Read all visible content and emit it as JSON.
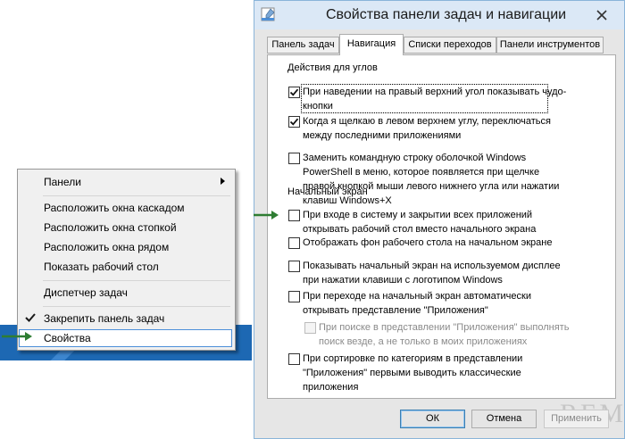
{
  "context_menu": {
    "items": [
      {
        "label": "Панели",
        "submenu": true
      },
      {
        "label": "Расположить окна каскадом"
      },
      {
        "label": "Расположить окна стопкой"
      },
      {
        "label": "Расположить окна рядом"
      },
      {
        "label": "Показать рабочий стол"
      },
      {
        "label": "Диспетчер задач"
      },
      {
        "label": "Закрепить панель задач",
        "checked": true
      },
      {
        "label": "Свойства",
        "highlighted": true
      }
    ]
  },
  "dialog": {
    "title": "Свойства панели задач и навигации",
    "tabs": [
      {
        "label": "Панель задач",
        "active": false
      },
      {
        "label": "Навигация",
        "active": true
      },
      {
        "label": "Списки переходов",
        "active": false
      },
      {
        "label": "Панели инструментов",
        "active": false
      }
    ],
    "corners_section": {
      "heading": "Действия для углов",
      "options": [
        {
          "text": "При наведении на правый верхний угол показывать чудо-кнопки",
          "checked": true
        },
        {
          "text": "Когда я щелкаю в левом верхнем углу, переключаться между последними приложениями",
          "checked": true
        },
        {
          "text": "Заменить командную строку оболочкой Windows PowerShell в меню, которое появляется при щелчке правой кнопкой мыши левого нижнего угла или нажатии клавиш Windows+X",
          "checked": false
        }
      ]
    },
    "start_section": {
      "heading": "Начальный экран",
      "options": [
        {
          "text": "При входе в систему и закрытии всех приложений открывать рабочий стол вместо начального экрана",
          "checked": false
        },
        {
          "text": "Отображать фон рабочего стола на начальном экране",
          "checked": false
        },
        {
          "text": "Показывать начальный экран на используемом дисплее при нажатии клавиши с логотипом Windows",
          "checked": false
        },
        {
          "text": "При переходе на начальный экран автоматически открывать представление \"Приложения\"",
          "checked": false
        },
        {
          "text": "При поиске в представлении \"Приложения\" выполнять поиск везде, а не только в моих приложениях",
          "checked": false,
          "disabled": true
        },
        {
          "text": "При сортировке по категориям в представлении \"Приложения\" первыми выводить классические приложения",
          "checked": false
        }
      ]
    },
    "buttons": {
      "ok": "ОК",
      "cancel": "Отмена",
      "apply": "Применить"
    },
    "watermark": "REMONTKA.COM"
  },
  "colors": {
    "accent": "#4d90d9",
    "taskbar": "#1d68b3",
    "arrow": "#2e7d32",
    "titlebar": "#dbe8f6"
  }
}
